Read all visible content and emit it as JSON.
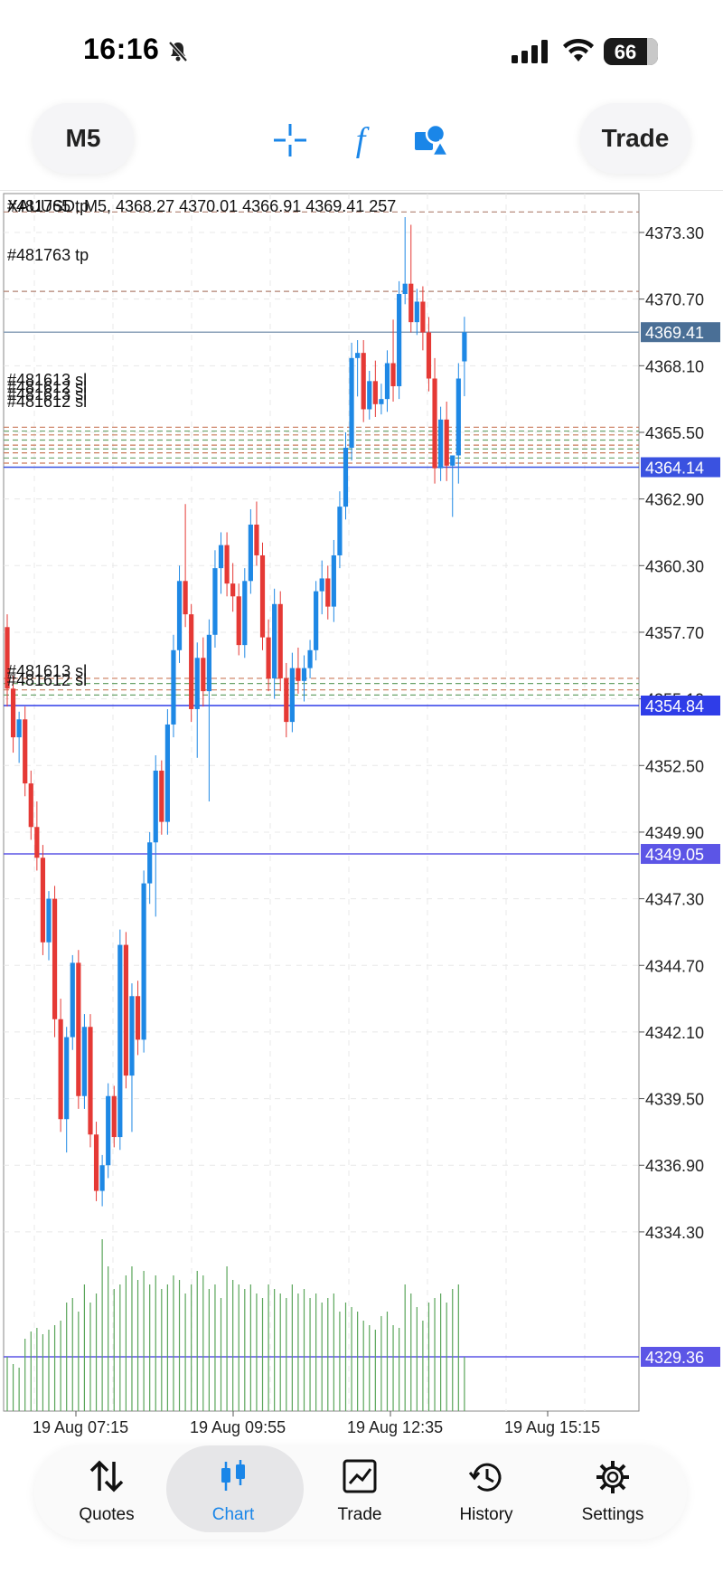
{
  "status": {
    "time": "16:16",
    "battery": "66"
  },
  "toolbar": {
    "timeframe": "M5",
    "trade_label": "Trade",
    "icons": [
      "crosshair-icon",
      "function-icon",
      "objects-icon"
    ]
  },
  "chart": {
    "info_line": "XAUUSD, M5, 4368.27 4370.01 4366.91 4369.41 257",
    "overlap_label": "#481765 tp",
    "tp_label": "#481763 tp",
    "sl_labels": [
      "#481613 sl",
      "#481612 sl"
    ],
    "price_ticks": [
      "4373.30",
      "4370.70",
      "4368.10",
      "4365.50",
      "4362.90",
      "4360.30",
      "4357.70",
      "4355.10",
      "4352.50",
      "4349.90",
      "4347.30",
      "4344.70",
      "4342.10",
      "4339.50",
      "4336.90",
      "4334.30"
    ],
    "price_badges": [
      {
        "label": "4369.41",
        "color": "#4a6f96"
      },
      {
        "label": "4364.14",
        "color": "#3a52e0"
      },
      {
        "label": "4354.84",
        "color": "#2f3de8"
      },
      {
        "label": "4349.05",
        "color": "#5c55e6"
      },
      {
        "label": "4329.36",
        "color": "#5c55e6"
      }
    ],
    "time_labels": [
      "19 Aug 07:15",
      "19 Aug 09:55",
      "19 Aug 12:35",
      "19 Aug 15:15"
    ],
    "colors": {
      "bull": "#1e88e5",
      "bear": "#e53935",
      "volume": "#5aa55a",
      "grid": "#e8e8e8"
    }
  },
  "chart_data": {
    "type": "candlestick",
    "symbol": "XAUUSD",
    "timeframe": "M5",
    "ylim": [
      4332.0,
      4375.0
    ],
    "last": {
      "open": 4368.27,
      "high": 4370.01,
      "low": 4366.91,
      "close": 4369.41,
      "volume": 257
    },
    "candles": [
      [
        4357.9,
        4358.4,
        4354.8,
        4355.5
      ],
      [
        4355.5,
        4356.0,
        4353.0,
        4353.6
      ],
      [
        4353.6,
        4354.6,
        4352.6,
        4354.3
      ],
      [
        4354.3,
        4354.8,
        4351.3,
        4351.8
      ],
      [
        4351.8,
        4352.3,
        4349.6,
        4350.1
      ],
      [
        4350.1,
        4351.1,
        4348.4,
        4348.9
      ],
      [
        4348.9,
        4349.4,
        4345.1,
        4345.6
      ],
      [
        4345.6,
        4347.6,
        4344.9,
        4347.3
      ],
      [
        4347.3,
        4347.8,
        4341.9,
        4342.6
      ],
      [
        4342.6,
        4343.4,
        4338.2,
        4338.7
      ],
      [
        4338.7,
        4342.3,
        4337.4,
        4341.9
      ],
      [
        4341.9,
        4345.1,
        4341.4,
        4344.8
      ],
      [
        4344.8,
        4345.3,
        4339.1,
        4339.6
      ],
      [
        4339.6,
        4342.8,
        4339.1,
        4342.3
      ],
      [
        4342.3,
        4342.8,
        4337.6,
        4338.1
      ],
      [
        4338.1,
        4338.6,
        4335.5,
        4335.9
      ],
      [
        4335.9,
        4337.3,
        4335.3,
        4336.9
      ],
      [
        4336.9,
        4340.1,
        4336.4,
        4339.6
      ],
      [
        4339.6,
        4340.0,
        4337.6,
        4338.0
      ],
      [
        4338.0,
        4346.1,
        4337.5,
        4345.5
      ],
      [
        4345.5,
        4346.0,
        4339.9,
        4340.4
      ],
      [
        4340.4,
        4344.0,
        4338.2,
        4343.5
      ],
      [
        4343.5,
        4344.1,
        4341.2,
        4341.8
      ],
      [
        4341.8,
        4348.4,
        4341.3,
        4347.9
      ],
      [
        4347.9,
        4349.9,
        4347.1,
        4349.5
      ],
      [
        4349.5,
        4352.9,
        4346.6,
        4352.3
      ],
      [
        4352.3,
        4352.7,
        4349.8,
        4350.3
      ],
      [
        4350.3,
        4354.7,
        4349.8,
        4354.1
      ],
      [
        4354.1,
        4357.6,
        4353.6,
        4357.0
      ],
      [
        4357.0,
        4360.3,
        4356.5,
        4359.7
      ],
      [
        4359.7,
        4362.7,
        4357.9,
        4358.4
      ],
      [
        4358.4,
        4358.8,
        4354.2,
        4354.7
      ],
      [
        4354.7,
        4357.3,
        4352.8,
        4356.7
      ],
      [
        4356.7,
        4357.5,
        4354.8,
        4355.4
      ],
      [
        4355.4,
        4358.2,
        4351.1,
        4357.6
      ],
      [
        4357.6,
        4360.9,
        4357.1,
        4360.2
      ],
      [
        4360.2,
        4361.6,
        4359.2,
        4361.1
      ],
      [
        4361.1,
        4361.6,
        4359.1,
        4359.6
      ],
      [
        4359.6,
        4360.4,
        4358.5,
        4359.1
      ],
      [
        4359.1,
        4359.6,
        4356.8,
        4357.2
      ],
      [
        4357.2,
        4360.2,
        4356.7,
        4359.7
      ],
      [
        4359.7,
        4362.5,
        4359.2,
        4361.9
      ],
      [
        4361.9,
        4362.8,
        4360.3,
        4360.7
      ],
      [
        4360.7,
        4361.2,
        4357.0,
        4357.5
      ],
      [
        4357.5,
        4358.2,
        4355.4,
        4355.9
      ],
      [
        4355.9,
        4359.4,
        4355.1,
        4358.8
      ],
      [
        4358.8,
        4359.3,
        4355.4,
        4355.9
      ],
      [
        4355.9,
        4356.5,
        4353.6,
        4354.2
      ],
      [
        4354.2,
        4356.9,
        4353.8,
        4356.3
      ],
      [
        4356.3,
        4357.1,
        4355.3,
        4355.8
      ],
      [
        4355.8,
        4356.8,
        4355.0,
        4356.3
      ],
      [
        4356.3,
        4357.4,
        4355.9,
        4357.0
      ],
      [
        4357.0,
        4359.7,
        4356.6,
        4359.3
      ],
      [
        4359.3,
        4360.5,
        4358.4,
        4359.8
      ],
      [
        4359.8,
        4360.3,
        4358.2,
        4358.7
      ],
      [
        4358.7,
        4361.3,
        4358.1,
        4360.7
      ],
      [
        4360.7,
        4363.2,
        4360.2,
        4362.6
      ],
      [
        4362.6,
        4365.5,
        4362.1,
        4364.9
      ],
      [
        4364.9,
        4369.0,
        4364.4,
        4368.4
      ],
      [
        4368.4,
        4369.1,
        4366.9,
        4368.6
      ],
      [
        4368.6,
        4369.1,
        4365.9,
        4366.4
      ],
      [
        4366.4,
        4367.9,
        4366.0,
        4367.5
      ],
      [
        4367.5,
        4368.3,
        4366.1,
        4366.6
      ],
      [
        4366.6,
        4367.4,
        4366.2,
        4366.8
      ],
      [
        4366.8,
        4368.7,
        4366.3,
        4368.2
      ],
      [
        4368.2,
        4369.9,
        4366.7,
        4367.3
      ],
      [
        4367.3,
        4371.4,
        4366.8,
        4370.9
      ],
      [
        4370.9,
        4373.9,
        4370.5,
        4371.3
      ],
      [
        4371.3,
        4373.6,
        4369.4,
        4369.8
      ],
      [
        4369.8,
        4371.1,
        4369.3,
        4370.6
      ],
      [
        4370.6,
        4371.2,
        4368.7,
        4369.4
      ],
      [
        4369.4,
        4370.0,
        4367.1,
        4367.6
      ],
      [
        4367.6,
        4368.4,
        4363.5,
        4364.1
      ],
      [
        4364.1,
        4366.5,
        4363.6,
        4366.0
      ],
      [
        4366.0,
        4366.7,
        4363.6,
        4364.2
      ],
      [
        4364.2,
        4364.6,
        4362.2,
        4364.6
      ],
      [
        4364.6,
        4368.2,
        4363.5,
        4367.6
      ],
      [
        4368.27,
        4370.01,
        4366.91,
        4369.41
      ]
    ],
    "volumes": [
      60,
      52,
      48,
      80,
      88,
      92,
      85,
      90,
      95,
      100,
      120,
      125,
      110,
      140,
      120,
      130,
      190,
      160,
      135,
      140,
      150,
      160,
      145,
      155,
      140,
      150,
      135,
      140,
      150,
      145,
      130,
      140,
      155,
      150,
      135,
      140,
      125,
      160,
      145,
      140,
      135,
      140,
      130,
      125,
      140,
      135,
      130,
      125,
      140,
      130,
      135,
      125,
      130,
      120,
      125,
      130,
      110,
      120,
      115,
      110,
      100,
      95,
      90,
      105,
      110,
      95,
      92,
      140,
      130,
      115,
      100,
      120,
      125,
      130,
      120,
      135,
      140,
      60
    ]
  }
}
